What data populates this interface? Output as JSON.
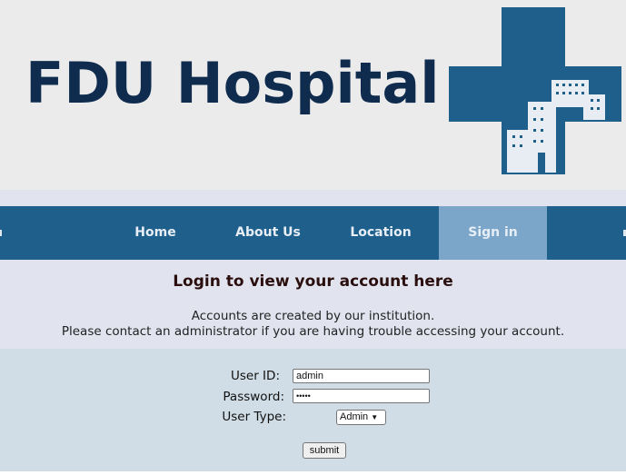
{
  "header": {
    "brand_text": "FDU Hospital",
    "logo_icon": "hospital-cross-icon",
    "logo_color": "#1e5f8c"
  },
  "nav": {
    "items": [
      {
        "label": "Home",
        "active": false
      },
      {
        "label": "About Us",
        "active": false
      },
      {
        "label": "Location",
        "active": false
      },
      {
        "label": "Sign in",
        "active": true
      }
    ],
    "background": "#1e5f8c",
    "active_background": "#7ba5c9"
  },
  "info": {
    "heading": "Login to view your account here",
    "line1": "Accounts are created by our institution.",
    "line2": "Please contact an administrator if you are having trouble accessing your account."
  },
  "form": {
    "user_id_label": "User ID:",
    "user_id_value": "admin",
    "password_label": "Password:",
    "password_value": "•••••",
    "user_type_label": "User Type:",
    "user_type_value": "Admin",
    "submit_label": "submit"
  }
}
